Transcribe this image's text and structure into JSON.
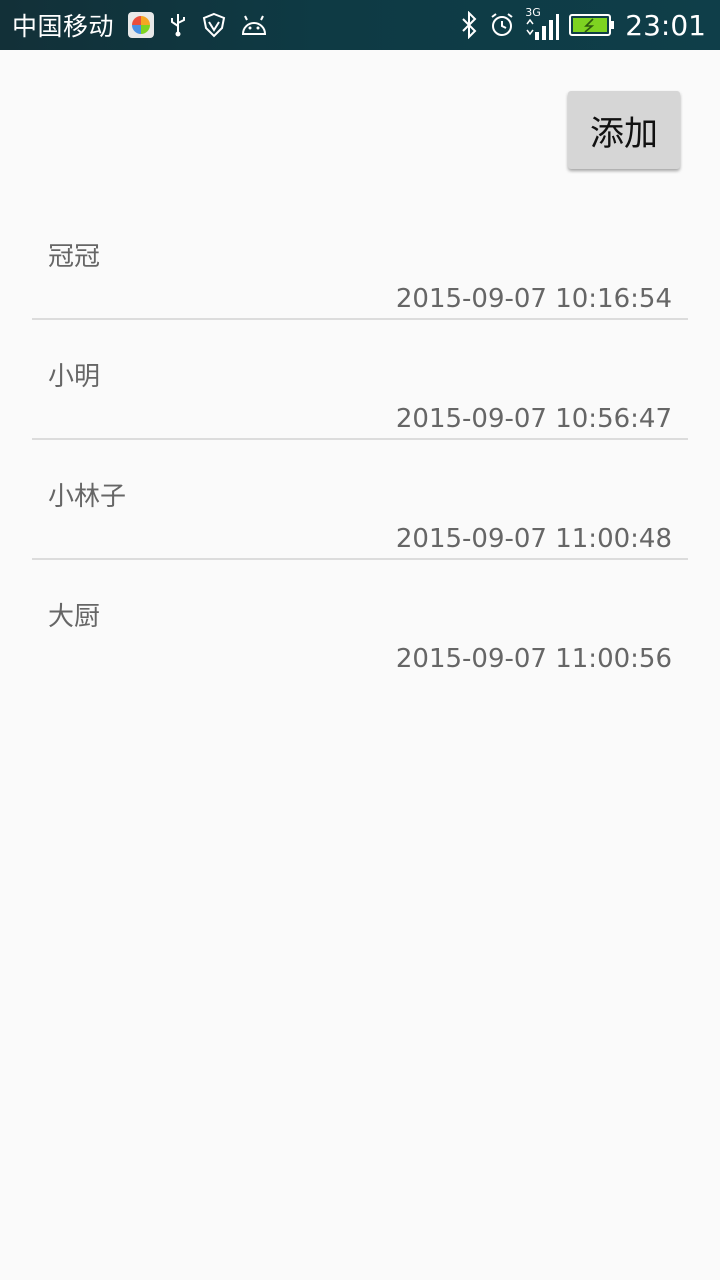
{
  "status_bar": {
    "carrier": "中国移动",
    "network": "3G",
    "time": "23:01"
  },
  "toolbar": {
    "add_label": "添加"
  },
  "list": {
    "items": [
      {
        "name": "冠冠",
        "time": "2015-09-07 10:16:54"
      },
      {
        "name": "小明",
        "time": "2015-09-07 10:56:47"
      },
      {
        "name": "小林子",
        "time": "2015-09-07 11:00:48"
      },
      {
        "name": "大厨",
        "time": "2015-09-07 11:00:56"
      }
    ]
  },
  "colors": {
    "status_bar": "#0f3e49",
    "background": "#fafafa",
    "button": "#d6d6d6",
    "battery": "#7ed321"
  }
}
